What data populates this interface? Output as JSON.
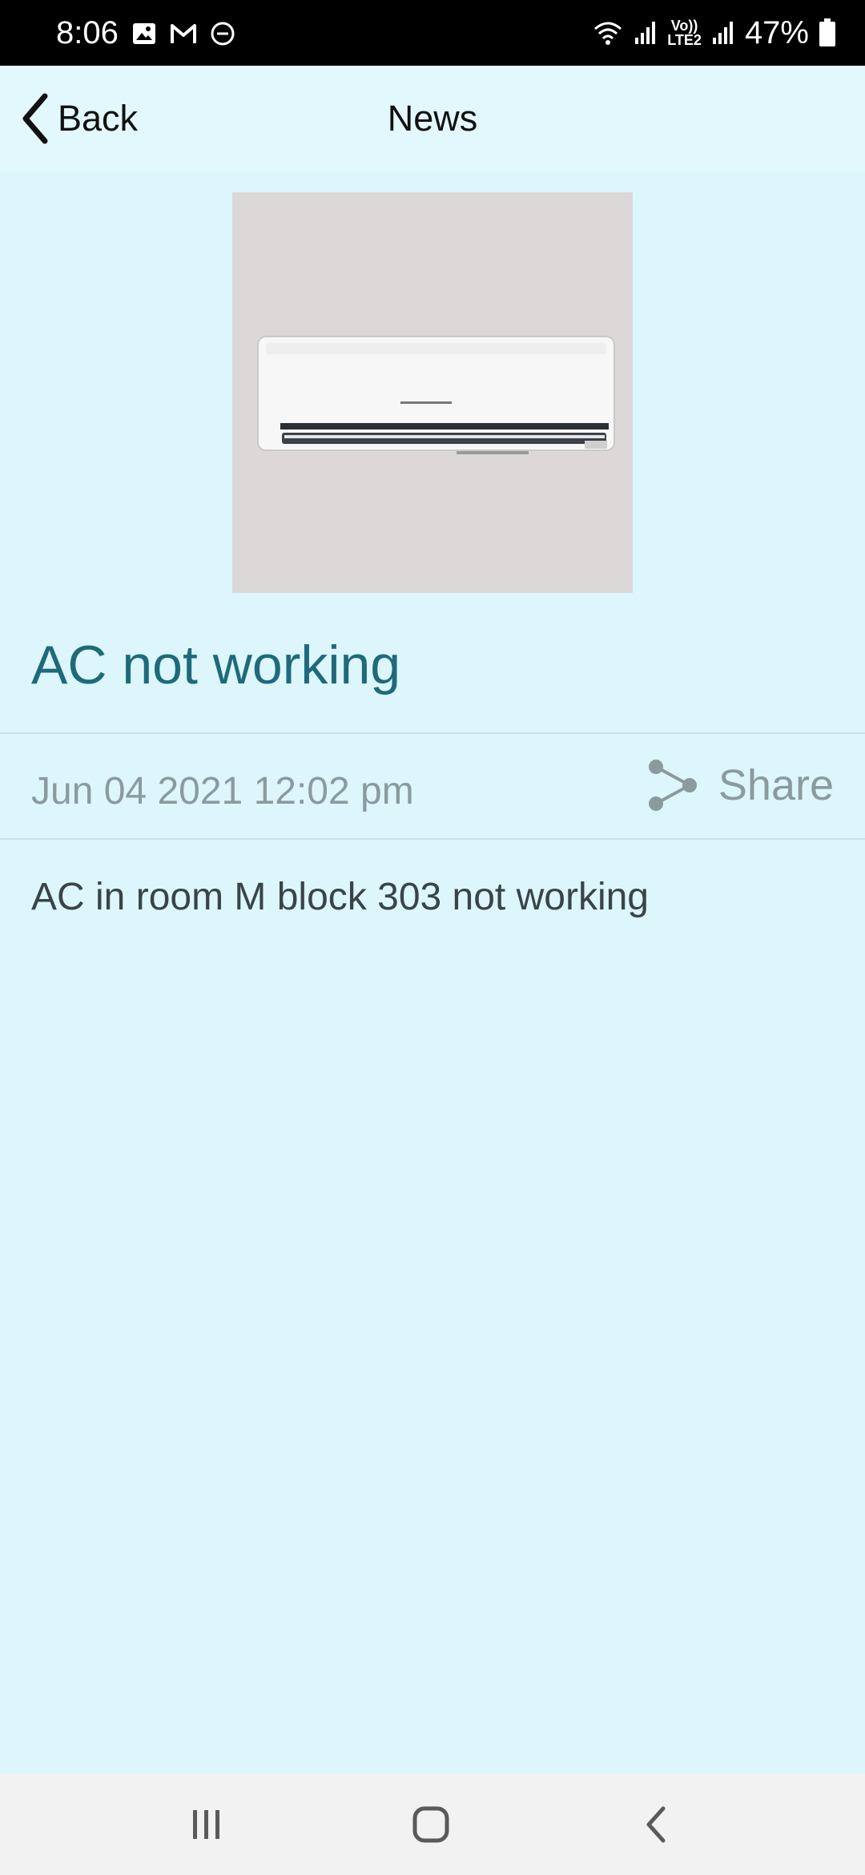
{
  "status_bar": {
    "time": "8:06",
    "battery": "47%",
    "network": "LTE2",
    "volte": "Vo))",
    "icons": [
      "image-icon",
      "gmail-icon",
      "dnd-icon",
      "wifi-icon",
      "signal-icon",
      "battery-icon"
    ]
  },
  "header": {
    "back_label": "Back",
    "title": "News"
  },
  "article": {
    "title": "AC not working",
    "date": "Jun 04 2021 12:02 pm",
    "share_label": "Share",
    "body": "AC in room M block 303 not working"
  },
  "colors": {
    "background": "#dcf6fc",
    "title": "#1e6a7b",
    "muted": "#8b9a9d"
  },
  "nav": {
    "icons": [
      "recent-apps-icon",
      "home-icon",
      "back-nav-icon"
    ]
  }
}
